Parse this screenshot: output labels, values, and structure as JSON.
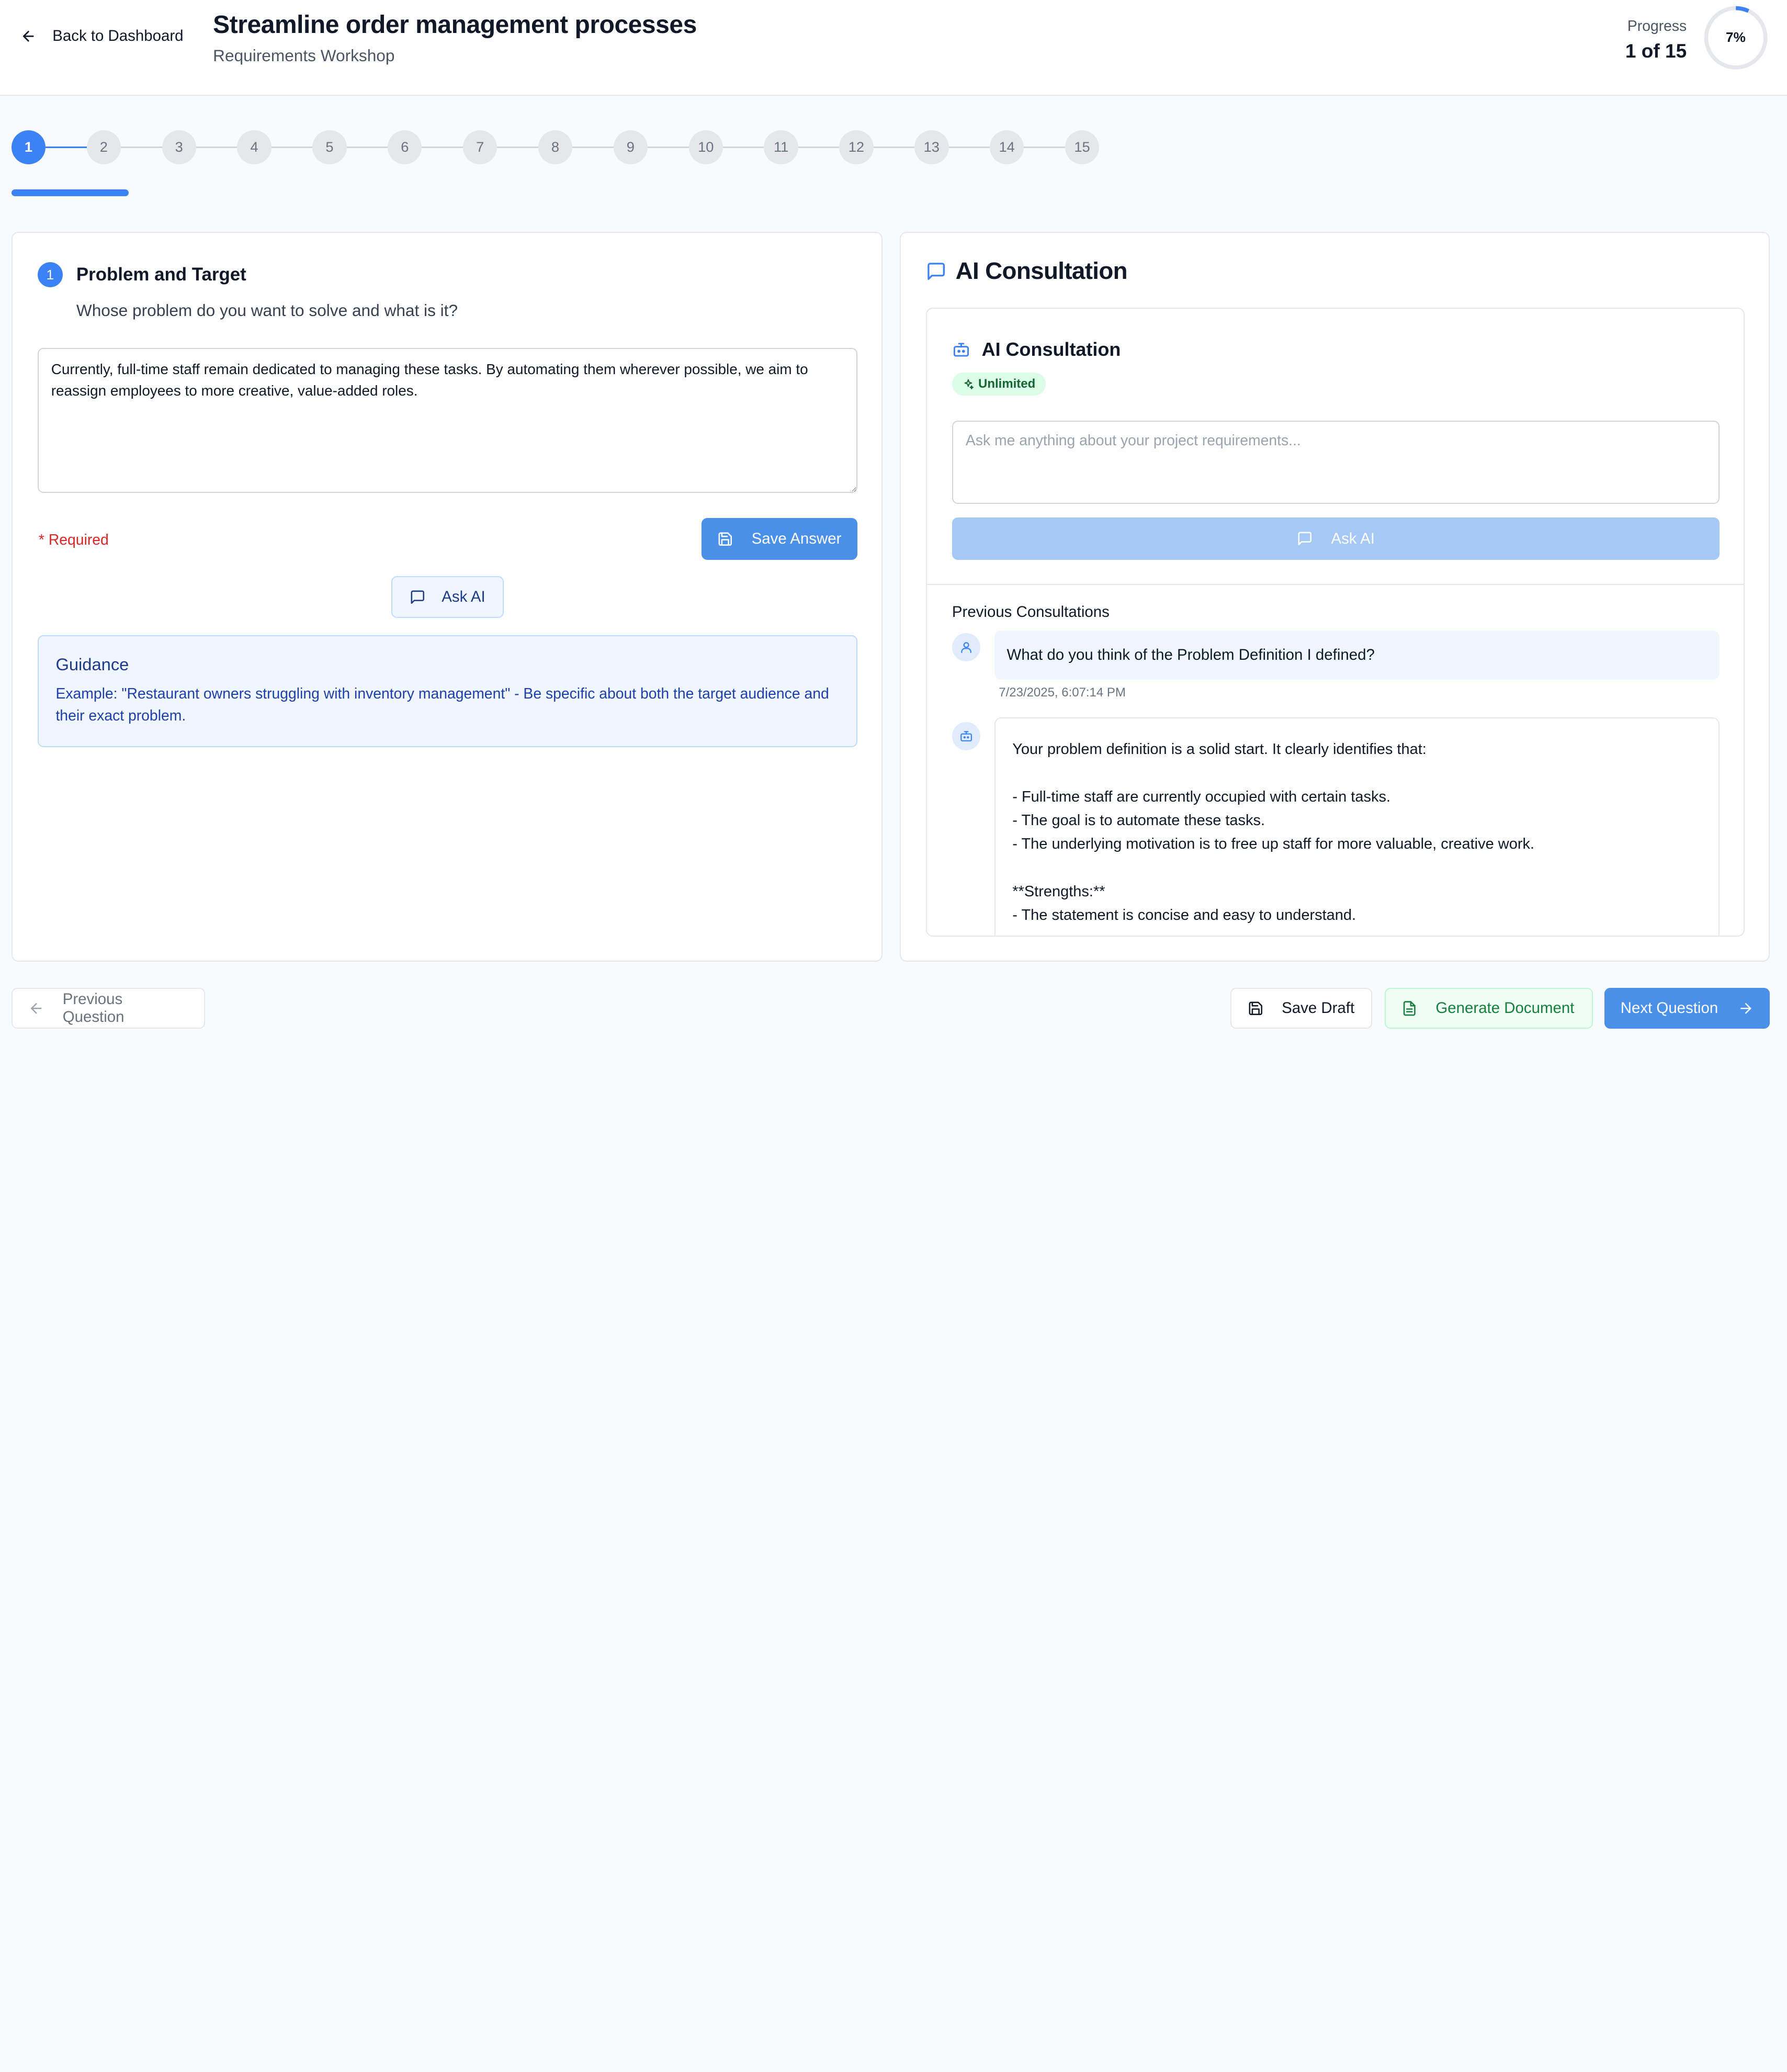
{
  "header": {
    "back_label": "Back to Dashboard",
    "title": "Streamline order management processes",
    "subtitle": "Requirements Workshop",
    "progress_label": "Progress",
    "progress_count": "1 of 15",
    "progress_percent_label": "7%",
    "progress_fraction": 0.07
  },
  "stepper": {
    "steps": [
      "1",
      "2",
      "3",
      "4",
      "5",
      "6",
      "7",
      "8",
      "9",
      "10",
      "11",
      "12",
      "13",
      "14",
      "15"
    ],
    "current": 1
  },
  "question": {
    "number": "1",
    "title": "Problem and Target",
    "text": "Whose problem do you want to solve and what is it?",
    "answer": "Currently, full-time staff remain dedicated to managing these tasks. By automating them wherever possible, we aim to reassign employees to more creative, value-added roles.",
    "required_label": "* Required",
    "save_label": "Save Answer",
    "ask_ai_label": "Ask AI",
    "guidance_title": "Guidance",
    "guidance_text": "Example: \"Restaurant owners struggling with inventory management\" - Be specific about both the target audience and their exact problem."
  },
  "ai": {
    "panel_title": "AI Consultation",
    "card_title": "AI Consultation",
    "badge": "Unlimited",
    "input_placeholder": "Ask me anything about your project requirements...",
    "ask_label": "Ask AI",
    "previous_title": "Previous Consultations",
    "user_message": "What do you think of the Problem Definition I defined?",
    "user_time": "7/23/2025, 6:07:14 PM",
    "ai_response": "Your problem definition is a solid start. It clearly identifies that:\n\n- Full-time staff are currently occupied with certain tasks.\n- The goal is to automate these tasks.\n- The underlying motivation is to free up staff for more valuable, creative work.\n\n**Strengths:**\n- The statement is concise and easy to understand."
  },
  "footer": {
    "previous_label": "Previous Question",
    "save_draft_label": "Save Draft",
    "generate_label": "Generate Document",
    "next_label": "Next Question"
  },
  "colors": {
    "accent": "#3b82f6",
    "required": "#dc2626",
    "success": "#15803d"
  }
}
